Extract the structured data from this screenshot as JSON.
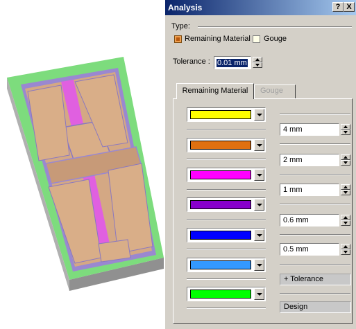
{
  "dialog": {
    "title": "Analysis",
    "help_button": "?",
    "close_button": "X",
    "type_label": "Type:",
    "options": {
      "remaining_material": {
        "label": "Remaining Material",
        "checked": true
      },
      "gouge": {
        "label": "Gouge",
        "checked": false
      }
    },
    "tolerance": {
      "label": "Tolerance :",
      "value": "0.01 mm"
    },
    "tabs": [
      {
        "label": "Remaining Material",
        "active": true
      },
      {
        "label": "Gouge",
        "active": false
      }
    ],
    "colors": [
      {
        "name": "yellow",
        "hex": "#ffff00"
      },
      {
        "name": "orange",
        "hex": "#e07010"
      },
      {
        "name": "magenta",
        "hex": "#ff00ff"
      },
      {
        "name": "purple",
        "hex": "#8800cc"
      },
      {
        "name": "blue",
        "hex": "#0000ff"
      },
      {
        "name": "light-blue",
        "hex": "#3399ff"
      },
      {
        "name": "green",
        "hex": "#00ff00"
      }
    ],
    "thresholds": [
      "4 mm",
      "2 mm",
      "1 mm",
      "0.6 mm",
      "0.5 mm"
    ],
    "plus_tolerance_label": "+ Tolerance",
    "design_label": "Design"
  },
  "viewport": {
    "stock_color": "#7ddc7d",
    "part_color": "#d4a884",
    "pocket_color": "#ff66ff",
    "wall_color": "#9a88d0"
  }
}
